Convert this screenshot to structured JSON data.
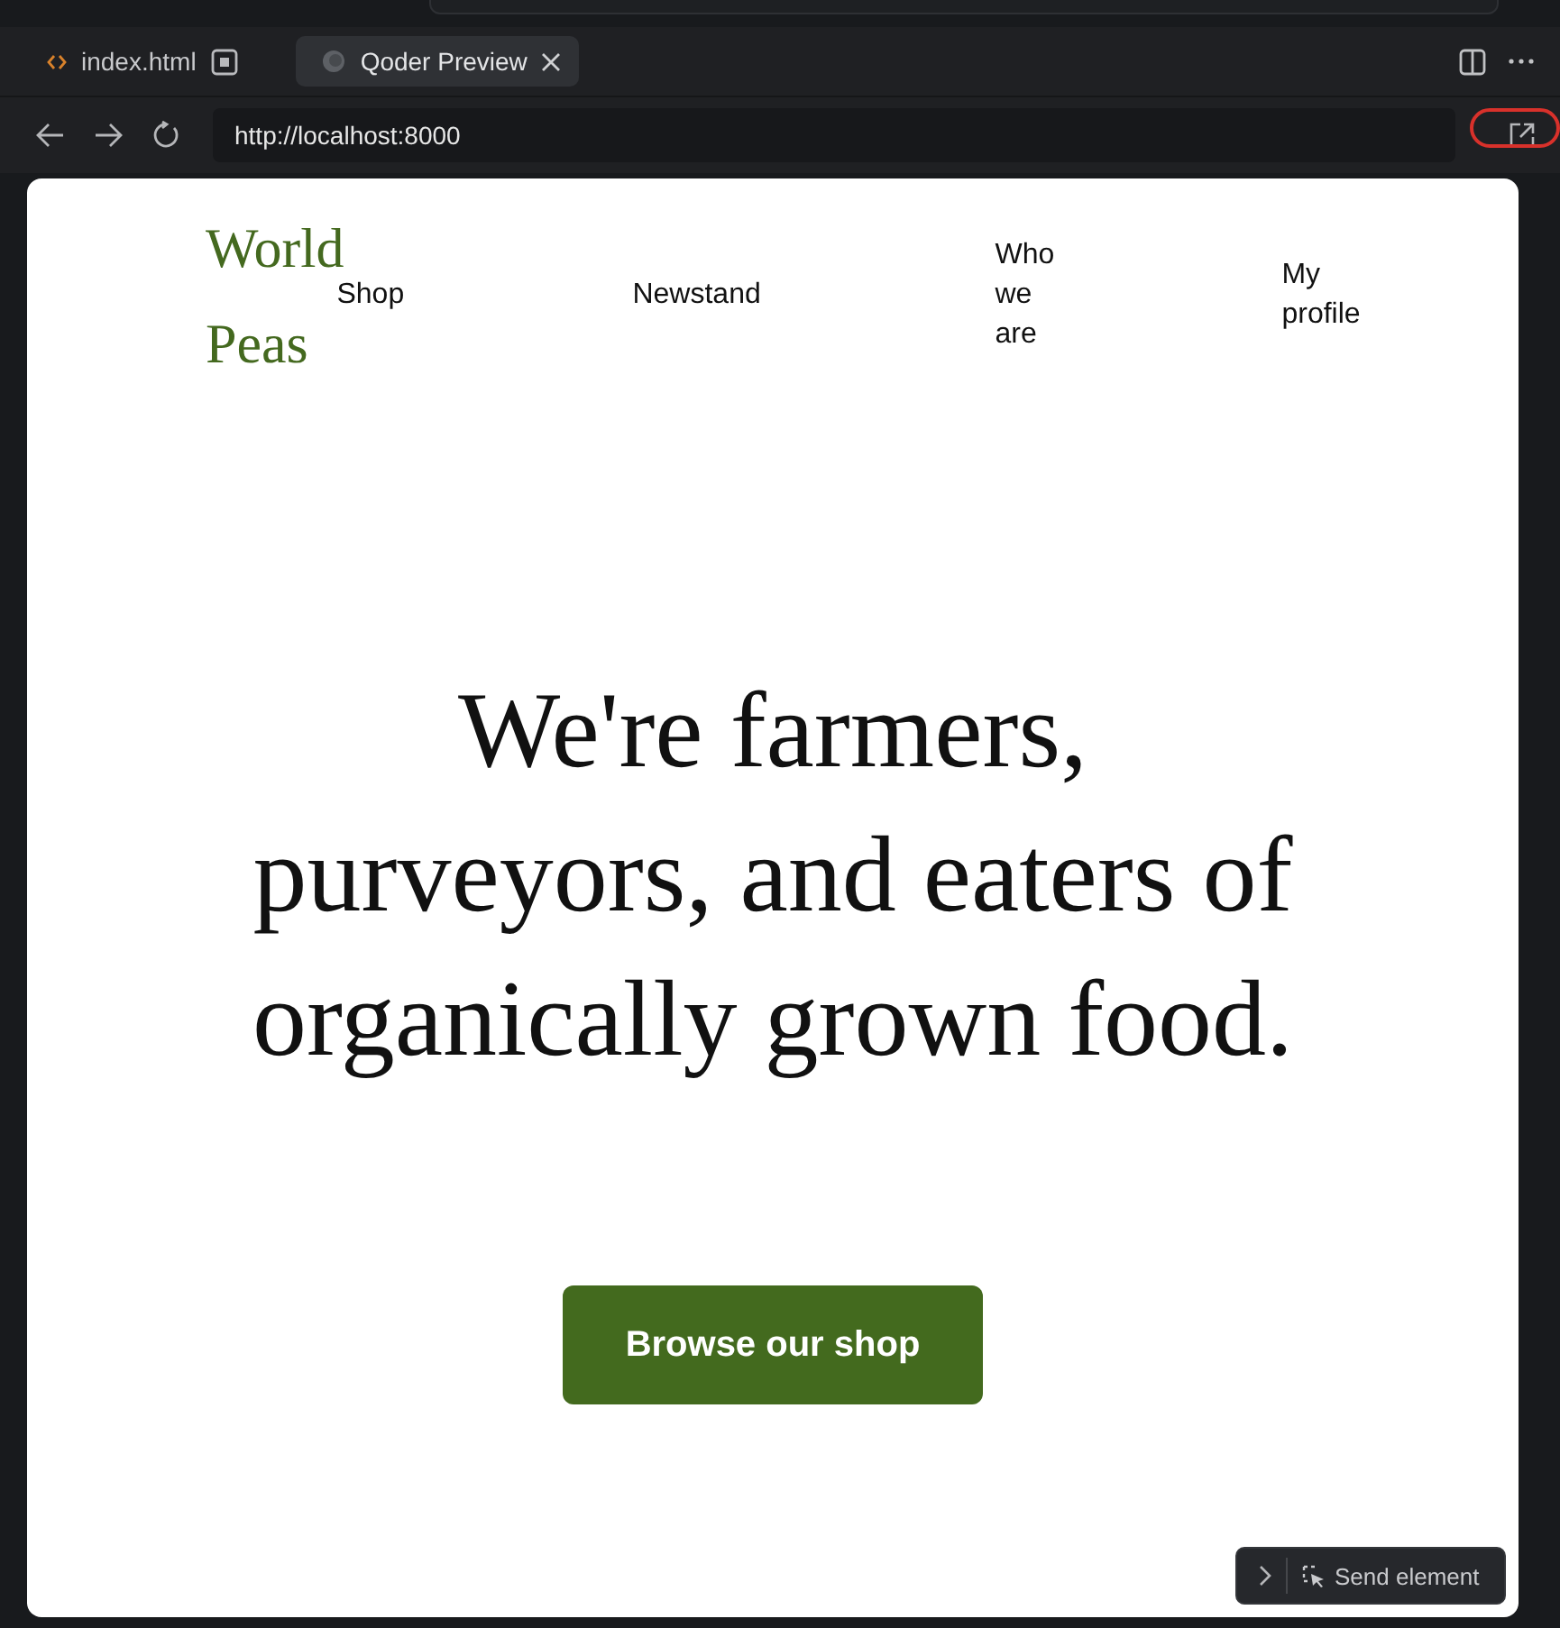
{
  "tabs": [
    {
      "label": "index.html",
      "selected": false,
      "kind": "file"
    },
    {
      "label": "Qoder Preview",
      "selected": true,
      "kind": "preview"
    }
  ],
  "address_bar": {
    "url": "http://localhost:8000"
  },
  "page": {
    "logo": "World Peas",
    "nav": [
      "Shop",
      "Newstand",
      "Who we are",
      "My profile"
    ],
    "headline": "We're farmers, purveyors, and eaters of organically grown food.",
    "cta": "Browse our shop"
  },
  "send_element": {
    "label": "Send element"
  }
}
